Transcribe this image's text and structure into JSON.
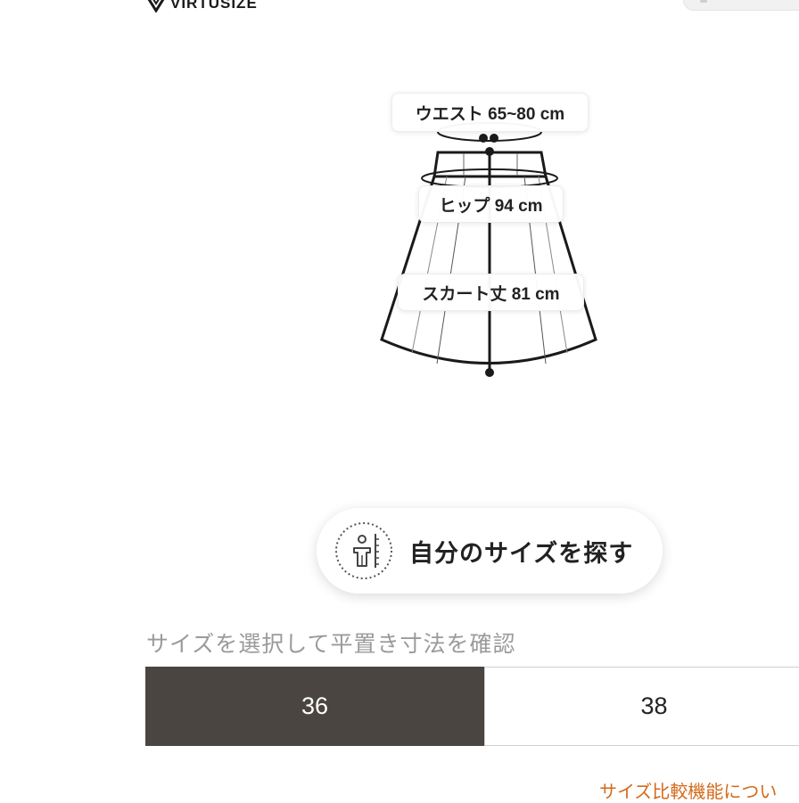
{
  "brand": {
    "name": "VIRTUSIZE",
    "logo_icon": "virtusize-logo-icon"
  },
  "measurements": {
    "waist": "ウエスト 65~80 cm",
    "hip": "ヒップ 94 cm",
    "length": "スカート丈 81 cm"
  },
  "find_size_button": {
    "label": "自分のサイズを探す",
    "icon": "body-measure-icon"
  },
  "size_prompt": "サイズを選択して平置き寸法を確認",
  "sizes": [
    {
      "label": "36",
      "selected": true
    },
    {
      "label": "38",
      "selected": false
    }
  ],
  "compare_link": "サイズ比較機能につい",
  "colors": {
    "selected_tab": "#4a4541",
    "link": "#d36a1a",
    "prompt_text": "#9a9a9a"
  }
}
